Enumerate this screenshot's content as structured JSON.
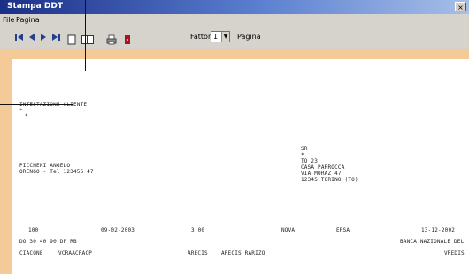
{
  "window": {
    "title": "Stampa DDT",
    "close_glyph": "×"
  },
  "menu": {
    "items": [
      "File",
      "Pagina"
    ]
  },
  "toolbar": {
    "zoom_label": "Fattore",
    "zoom_value": "1",
    "pages_label": "Pagina",
    "icons": [
      "first-page-icon",
      "prev-page-icon",
      "next-page-icon",
      "last-page-icon",
      "page-icon",
      "two-pages-icon",
      "print-icon",
      "exit-icon"
    ]
  },
  "document": {
    "heading": "INTESTAZIONE CLIENTE",
    "heading_sub1": "*",
    "heading_sub2": "*",
    "left_block": {
      "line1": "PICCHENI ANGELO",
      "line2": "ORENGO - Tel 123456 47"
    },
    "right_block": {
      "line1": "SR",
      "line2": "*",
      "line3": "TO 23",
      "line4": "CASA PARROCCA",
      "line5": "VIA MORAZ 47",
      "line6": "12345 TORINO (TO)"
    },
    "row1": {
      "col1": "100",
      "col2": "09-02-2003",
      "col3": "3.00",
      "col4": "NOVA",
      "col5": "ERSA",
      "col6": "13-12-2002"
    },
    "row2": {
      "left": "DO 30 40 90 DF RB",
      "right": "BANCA NAZIONALE DEL"
    },
    "row3": {
      "col1": "CIACONE",
      "col2": "VCRAACRACP",
      "col3": "ARECIS",
      "col4": "ARECIS RARIZO",
      "col5": "VREDIS"
    }
  }
}
